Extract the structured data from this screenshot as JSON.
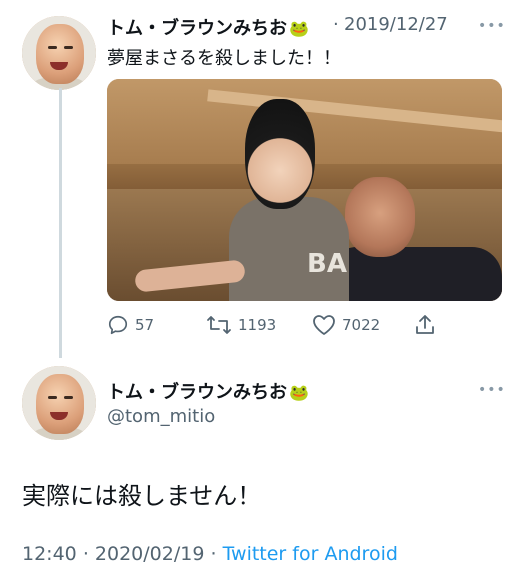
{
  "tweet1": {
    "name": "トム・ブラウンみちお",
    "separator": "·",
    "date": "2019/12/27",
    "more": "•••",
    "text": "夢屋まさるを殺しました！！",
    "media_print": "BA",
    "actions": {
      "reply_count": "57",
      "retweet_count": "1193",
      "like_count": "7022"
    }
  },
  "tweet2": {
    "name": "トム・ブラウンみちお",
    "handle": "@tom_mitio",
    "more": "•••",
    "text": "実際には殺しません！",
    "time": "12:40",
    "dot": "·",
    "date": "2020/02/19",
    "source": "Twitter for Android"
  },
  "emoji": "🐸",
  "colors": {
    "text": "#0f1419",
    "secondary": "#536471",
    "link": "#1d9bf0",
    "thread_line": "#cfd9de"
  },
  "icons": [
    "reply-icon",
    "retweet-icon",
    "like-icon",
    "share-icon",
    "more-icon"
  ]
}
